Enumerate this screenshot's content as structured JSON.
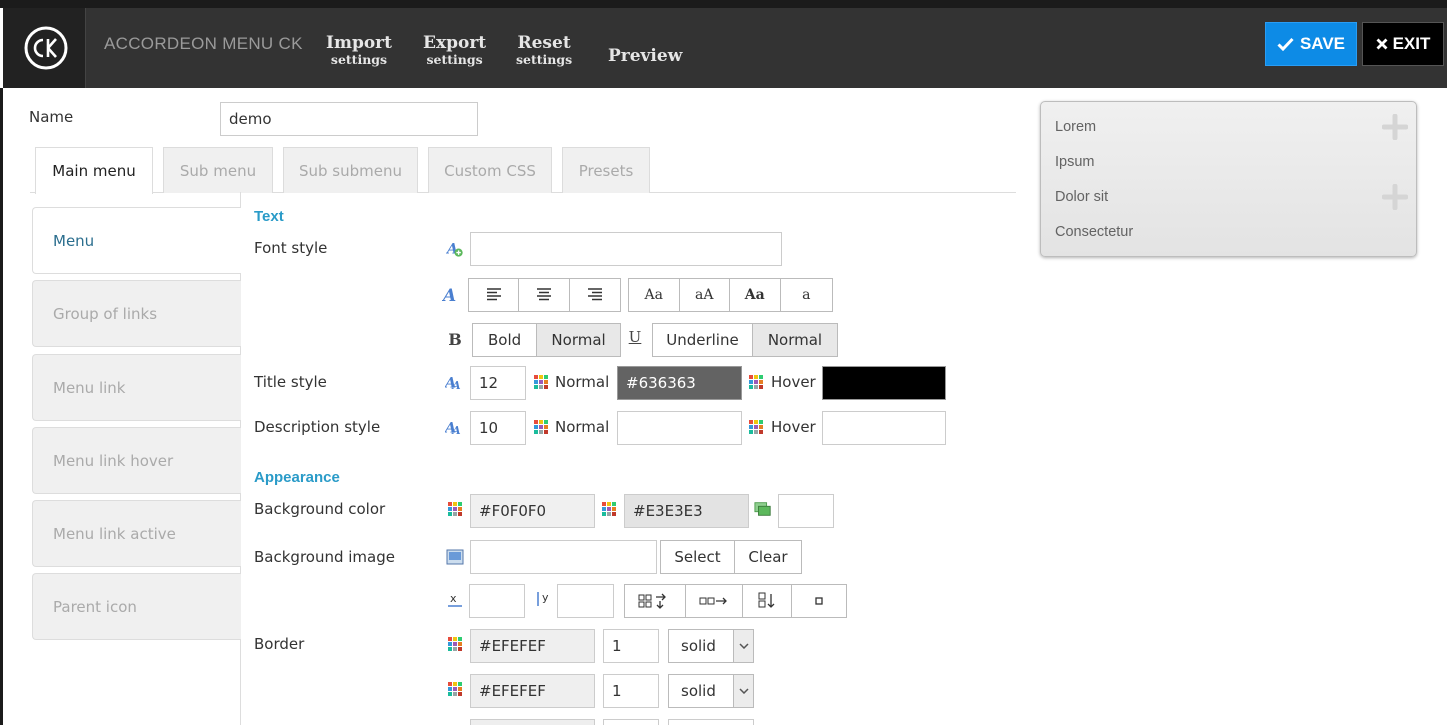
{
  "header": {
    "app_title": "ACCORDEON MENU CK",
    "nav": [
      {
        "l1": "Import",
        "l2": "settings"
      },
      {
        "l1": "Export",
        "l2": "settings"
      },
      {
        "l1": "Reset",
        "l2": "settings"
      }
    ],
    "preview_label": "Preview",
    "save_label": "SAVE",
    "exit_label": "EXIT"
  },
  "name": {
    "label": "Name",
    "value": "demo"
  },
  "tabs": [
    "Main menu",
    "Sub menu",
    "Sub submenu",
    "Custom CSS",
    "Presets"
  ],
  "side_menu": [
    "Menu",
    "Group of links",
    "Menu link",
    "Menu link hover",
    "Menu link active",
    "Parent icon"
  ],
  "form": {
    "section_text": "Text",
    "font_style_label": "Font style",
    "font_style_value": "",
    "bold_label": "Bold",
    "bold_normal_label": "Normal",
    "underline_label": "Underline",
    "underline_normal_label": "Normal",
    "case_buttons": [
      "Aa",
      "aA",
      "Aa",
      "a"
    ],
    "title_style_label": "Title style",
    "title_size": "12",
    "normal_label": "Normal",
    "hover_label": "Hover",
    "title_normal_color": "#636363",
    "title_hover_color": "",
    "description_style_label": "Description style",
    "description_size": "10",
    "description_normal_color": "",
    "description_hover_color": "",
    "section_appearance": "Appearance",
    "background_color_label": "Background color",
    "bg_color_1": "#F0F0F0",
    "bg_color_2": "#E3E3E3",
    "bg_opacity": "",
    "background_image_label": "Background image",
    "bg_image_value": "",
    "select_label": "Select",
    "clear_label": "Clear",
    "pos_x": "",
    "pos_y": "",
    "border_label": "Border",
    "borders": [
      {
        "color": "#EFEFEF",
        "width": "1",
        "style": "solid"
      },
      {
        "color": "#EFEFEF",
        "width": "1",
        "style": "solid"
      }
    ]
  },
  "preview": {
    "items": [
      "Lorem",
      "Ipsum",
      "Dolor sit",
      "Consectetur"
    ]
  },
  "colors": {
    "header_bg": "#333333",
    "accent": "#0d8be6",
    "section": "#2a9bc8",
    "title_normal_swatch": "#636363",
    "title_hover_swatch": "#000000"
  }
}
